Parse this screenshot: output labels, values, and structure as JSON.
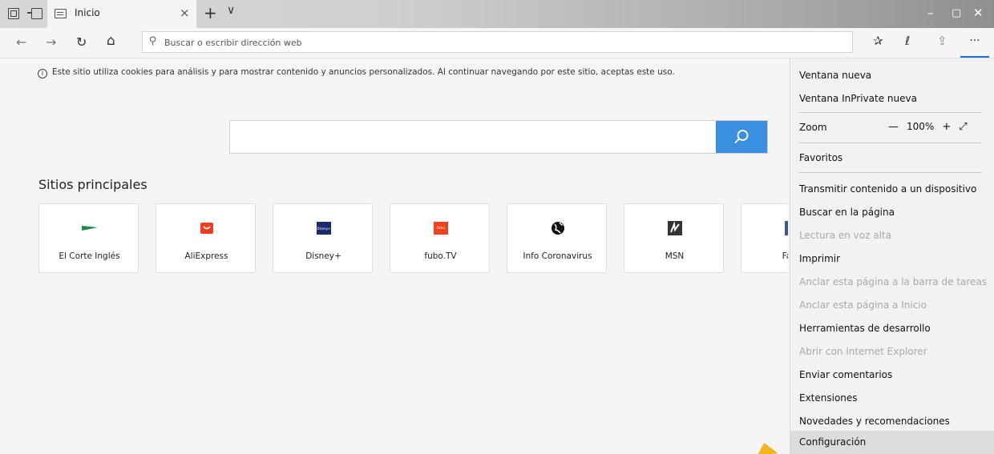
{
  "tab": {
    "title": "Inicio",
    "close": "×"
  },
  "titlebar": {
    "new_tab": "+",
    "tab_preview": "∨",
    "minimize": "–",
    "maximize": "▢",
    "close": "✕"
  },
  "nav": {
    "back": "←",
    "forward": "→",
    "refresh": "↻",
    "home": "⌂",
    "address_placeholder": "Buscar o escribir dirección web",
    "favorites": "✰",
    "pen": "ℓ",
    "share": "⇪",
    "more": "···"
  },
  "cookie": {
    "icon": "i",
    "text": "Este sitio utiliza cookies para análisis y para mostrar contenido y anuncios personalizados. Al continuar navegando por este sitio, aceptas este uso."
  },
  "main": {
    "sites_title": "Sitios principales",
    "tiles": [
      {
        "label": "El Corte Inglés",
        "logo_text": ""
      },
      {
        "label": "AliExpress",
        "logo_text": ""
      },
      {
        "label": "Disney+",
        "logo_text": "Disney+"
      },
      {
        "label": "fubo.TV",
        "logo_text": "fubo"
      },
      {
        "label": "Info Coronavirus",
        "logo_text": ""
      },
      {
        "label": "MSN",
        "logo_text": ""
      },
      {
        "label": "Face",
        "logo_text": ""
      }
    ]
  },
  "menu": {
    "items": [
      {
        "label": "Ventana nueva",
        "enabled": true
      },
      {
        "label": "Ventana InPrivate nueva",
        "enabled": true
      },
      {
        "label": "Zoom",
        "enabled": true
      },
      {
        "label": "Favoritos",
        "enabled": true
      },
      {
        "label": "Transmitir contenido a un dispositivo",
        "enabled": true
      },
      {
        "label": "Buscar en la página",
        "enabled": true
      },
      {
        "label": "Lectura en voz alta",
        "enabled": false
      },
      {
        "label": "Imprimir",
        "enabled": true
      },
      {
        "label": "Anclar esta página a la barra de tareas",
        "enabled": false
      },
      {
        "label": "Anclar esta página a Inicio",
        "enabled": false
      },
      {
        "label": "Herramientas de desarrollo",
        "enabled": true
      },
      {
        "label": "Abrir con Internet Explorer",
        "enabled": false
      },
      {
        "label": "Enviar comentarios",
        "enabled": true
      },
      {
        "label": "Extensiones",
        "enabled": true
      },
      {
        "label": "Novedades y recomendaciones",
        "enabled": true
      },
      {
        "label": "Configuración",
        "enabled": true,
        "highlighted": true
      }
    ],
    "zoom": {
      "minus": "—",
      "value": "100%",
      "plus": "+",
      "fullscreen": "⤢"
    }
  },
  "colors": {
    "accent": "#1a6fd1",
    "search_button": "#3b8fe0"
  }
}
